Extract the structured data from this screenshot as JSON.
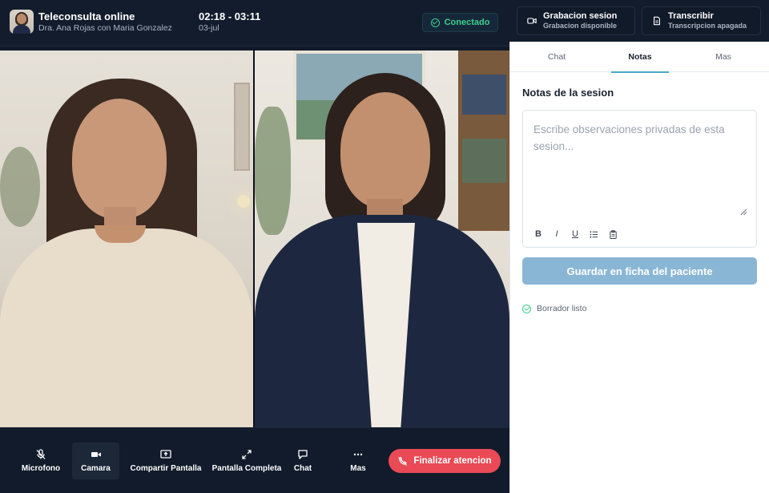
{
  "header": {
    "title": "Teleconsulta online",
    "subtitle": "Dra. Ana Rojas con Maria Gonzalez",
    "time_range": "02:18 - 03:11",
    "date": "03-jul",
    "status": "Conectado"
  },
  "session_actions": {
    "recording": {
      "title": "Grabacion sesion",
      "subtitle": "Grabacion disponible",
      "icon": "video-icon"
    },
    "transcribe": {
      "title": "Transcribir",
      "subtitle": "Transcripcion apagada",
      "icon": "document-icon"
    }
  },
  "tabs": [
    "Chat",
    "Notas",
    "Mas"
  ],
  "active_tab": "Notas",
  "notes": {
    "title": "Notas de la sesion",
    "placeholder": "Escribe observaciones privadas de esta sesion...",
    "value": "",
    "format_tools": [
      "B",
      "I",
      "U"
    ],
    "save_label": "Guardar en ficha del paciente",
    "draft_status": "Borrador listo"
  },
  "controls": {
    "mic": "Microfono",
    "camera": "Camara",
    "share": "Compartir Pantalla",
    "fullscreen": "Pantalla Completa",
    "chat": "Chat",
    "more": "Mas",
    "end": "Finalizar atencion"
  },
  "colors": {
    "accent": "#4aa6c8",
    "success": "#3ecf8e",
    "danger": "#e94a55",
    "save_button": "#8ab6d6",
    "dark_bg": "#101a2a"
  }
}
